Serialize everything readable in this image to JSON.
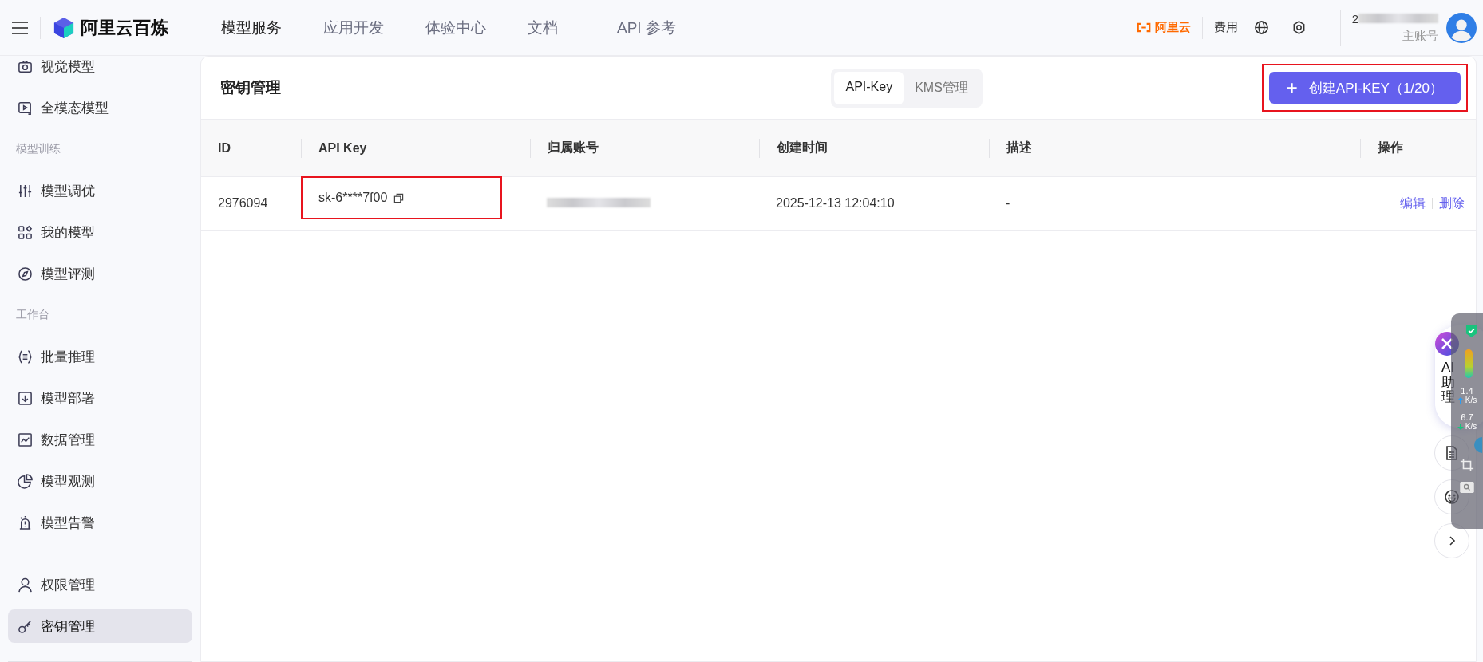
{
  "topbar": {
    "brand": "阿里云百炼",
    "nav": [
      {
        "label": "模型服务",
        "selected": true
      },
      {
        "label": "应用开发",
        "selected": false
      },
      {
        "label": "体验中心",
        "selected": false
      },
      {
        "label": "文档",
        "selected": false
      },
      {
        "label": "API 参考",
        "selected": false
      }
    ],
    "cloud_logo": "阿里云",
    "fee": "费用",
    "account": {
      "name": "2",
      "role": "主账号"
    }
  },
  "sidebar": {
    "items": [
      {
        "kind": "item",
        "label": "视觉模型",
        "selected": false
      },
      {
        "kind": "item",
        "label": "全模态模型",
        "selected": false
      },
      {
        "kind": "section",
        "label": "模型训练"
      },
      {
        "kind": "item",
        "label": "模型调优",
        "selected": false
      },
      {
        "kind": "item",
        "label": "我的模型",
        "selected": false
      },
      {
        "kind": "item",
        "label": "模型评测",
        "selected": false
      },
      {
        "kind": "section",
        "label": "工作台"
      },
      {
        "kind": "item",
        "label": "批量推理",
        "selected": false
      },
      {
        "kind": "item",
        "label": "模型部署",
        "selected": false
      },
      {
        "kind": "item",
        "label": "数据管理",
        "selected": false
      },
      {
        "kind": "item",
        "label": "模型观测",
        "selected": false
      },
      {
        "kind": "item",
        "label": "模型告警",
        "selected": false
      },
      {
        "kind": "gap"
      },
      {
        "kind": "item",
        "label": "权限管理",
        "selected": false
      },
      {
        "kind": "item",
        "label": "密钥管理",
        "selected": true
      }
    ]
  },
  "panel": {
    "title": "密钥管理",
    "tabs": [
      {
        "label": "API-Key",
        "selected": true
      },
      {
        "label": "KMS管理",
        "selected": false
      }
    ],
    "create_button": {
      "icon": "+",
      "label": "创建API-KEY（1/20）",
      "highlighted": true
    },
    "table": {
      "columns": [
        "ID",
        "API Key",
        "归属账号",
        "创建时间",
        "描述",
        "操作"
      ],
      "rows": [
        {
          "id": "2976094",
          "key": "sk-6****7f00",
          "key_highlighted": true,
          "account_redacted": true,
          "created": "2025-12-13 12:04:10",
          "description": "-",
          "actions": [
            "编辑",
            "删除"
          ]
        }
      ]
    }
  },
  "assistant": {
    "label": "AI助理"
  },
  "speed_overlay": {
    "up": "1.4",
    "up_unit": "K/s",
    "down": "6.7",
    "down_unit": "K/s"
  }
}
